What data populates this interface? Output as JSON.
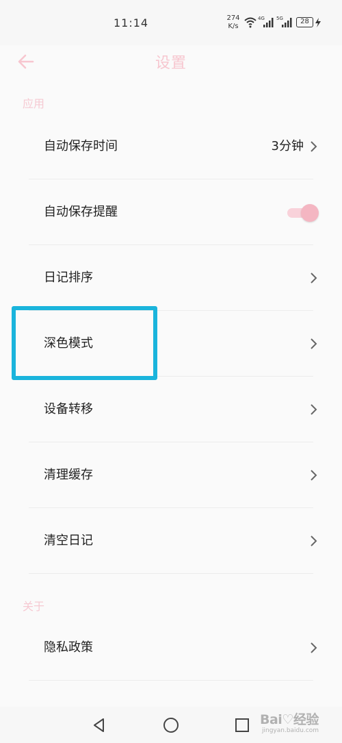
{
  "status_bar": {
    "time": "11:14",
    "net_speed_value": "274",
    "net_speed_unit": "K/s",
    "battery": "28",
    "icons": [
      "wifi-icon",
      "signal-4g-icon",
      "signal-5g-icon",
      "battery-icon",
      "charging-bolt-icon"
    ]
  },
  "header": {
    "title": "设置",
    "back_icon": "arrow-left-icon"
  },
  "sections": {
    "app_label": "应用",
    "about_label": "关于"
  },
  "settings": {
    "autosave_time_label": "自动保存时间",
    "autosave_time_value": "3分钟",
    "autosave_reminder_label": "自动保存提醒",
    "autosave_reminder_on": true,
    "diary_sort_label": "日记排序",
    "dark_mode_label": "深色模式",
    "device_transfer_label": "设备转移",
    "clear_cache_label": "清理缓存",
    "clear_diary_label": "清空日记",
    "privacy_policy_label": "隐私政策"
  },
  "nav_bar": {
    "icons": [
      "back-triangle-icon",
      "home-circle-icon",
      "recents-square-icon"
    ]
  },
  "watermark": {
    "text": "Bai♡经验",
    "subtext": "jingyan.baidu.com"
  },
  "colors": {
    "accent_pink": "#f7c6cf",
    "highlight_blue": "#1ab4dc",
    "background": "#fafafa"
  }
}
